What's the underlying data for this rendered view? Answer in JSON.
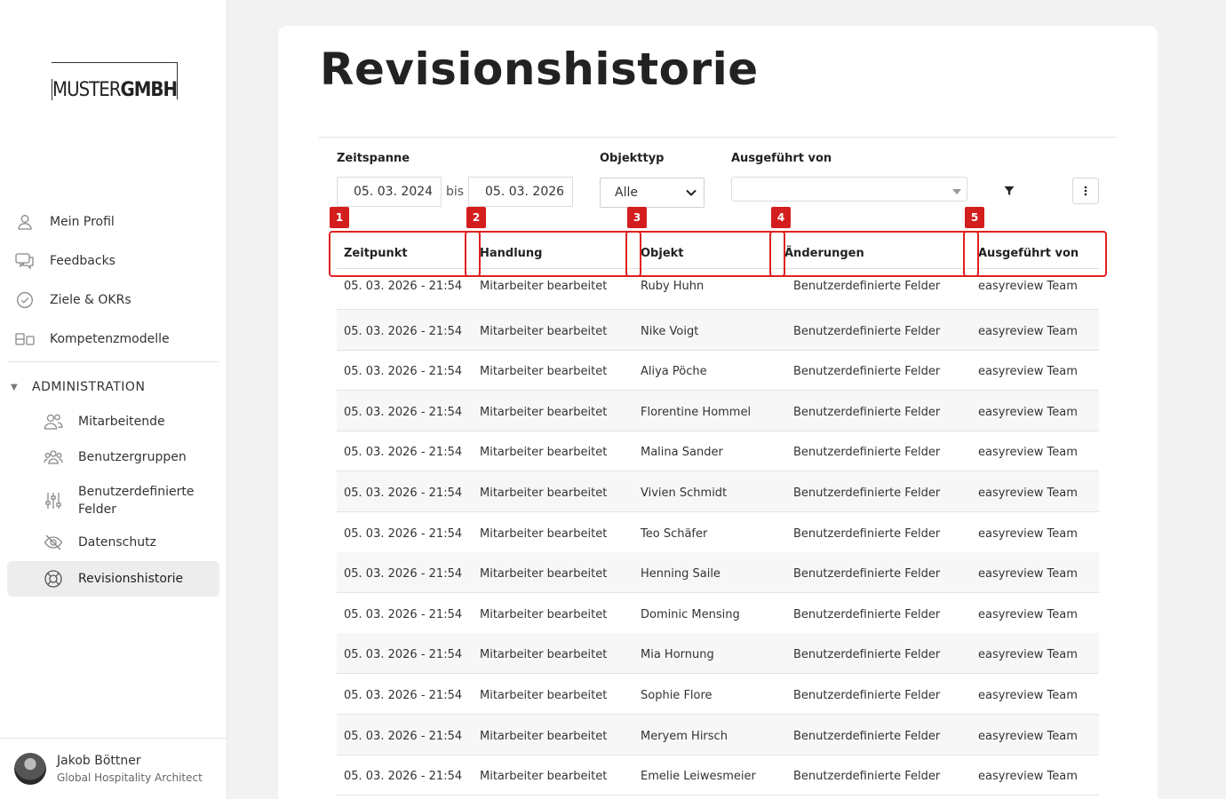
{
  "sidebar": {
    "logo": {
      "light": "MUSTER",
      "bold": "GMBH"
    },
    "items": [
      {
        "label": "Mein Profil",
        "icon": "user-icon"
      },
      {
        "label": "Feedbacks",
        "icon": "chat-icon"
      },
      {
        "label": "Ziele & OKRs",
        "icon": "check-circle-icon"
      },
      {
        "label": "Kompetenzmodelle",
        "icon": "blocks-icon"
      }
    ],
    "section": "ADMINISTRATION",
    "admin_items": [
      {
        "label": "Mitarbeitende",
        "icon": "people-icon"
      },
      {
        "label": "Benutzergruppen",
        "icon": "group-icon"
      },
      {
        "label": "Benutzerdefinierte Felder",
        "icon": "sliders-icon"
      },
      {
        "label": "Datenschutz",
        "icon": "eye-off-icon"
      },
      {
        "label": "Revisionshistorie",
        "icon": "lifebuoy-icon"
      }
    ],
    "user": {
      "name": "Jakob Böttner",
      "role": "Global Hospitality Architect"
    }
  },
  "main": {
    "title": "Revisionshistorie",
    "filters": {
      "zeitspanne_label": "Zeitspanne",
      "date_from": "05. 03. 2024",
      "bis": "bis",
      "date_to": "05. 03. 2026",
      "objekttyp_label": "Objekttyp",
      "objekttyp_value": "Alle",
      "ausgefuehrt_label": "Ausgeführt von",
      "ausgefuehrt_value": ""
    },
    "columns": [
      "Zeitpunkt",
      "Handlung",
      "Objekt",
      "Änderungen",
      "Ausgeführt von"
    ],
    "rows": [
      [
        "05. 03. 2026 - 21:54",
        "Mitarbeiter bearbeitet",
        "Ruby Huhn",
        "Benutzerdefinierte Felder",
        "easyreview Team"
      ],
      [
        "05. 03. 2026 - 21:54",
        "Mitarbeiter bearbeitet",
        "Nike Voigt",
        "Benutzerdefinierte Felder",
        "easyreview Team"
      ],
      [
        "05. 03. 2026 - 21:54",
        "Mitarbeiter bearbeitet",
        "Aliya Pöche",
        "Benutzerdefinierte Felder",
        "easyreview Team"
      ],
      [
        "05. 03. 2026 - 21:54",
        "Mitarbeiter bearbeitet",
        "Florentine Hommel",
        "Benutzerdefinierte Felder",
        "easyreview Team"
      ],
      [
        "05. 03. 2026 - 21:54",
        "Mitarbeiter bearbeitet",
        "Malina Sander",
        "Benutzerdefinierte Felder",
        "easyreview Team"
      ],
      [
        "05. 03. 2026 - 21:54",
        "Mitarbeiter bearbeitet",
        "Vivien Schmidt",
        "Benutzerdefinierte Felder",
        "easyreview Team"
      ],
      [
        "05. 03. 2026 - 21:54",
        "Mitarbeiter bearbeitet",
        "Teo Schäfer",
        "Benutzerdefinierte Felder",
        "easyreview Team"
      ],
      [
        "05. 03. 2026 - 21:54",
        "Mitarbeiter bearbeitet",
        "Henning Saile",
        "Benutzerdefinierte Felder",
        "easyreview Team"
      ],
      [
        "05. 03. 2026 - 21:54",
        "Mitarbeiter bearbeitet",
        "Dominic Mensing",
        "Benutzerdefinierte Felder",
        "easyreview Team"
      ],
      [
        "05. 03. 2026 - 21:54",
        "Mitarbeiter bearbeitet",
        "Mia Hornung",
        "Benutzerdefinierte Felder",
        "easyreview Team"
      ],
      [
        "05. 03. 2026 - 21:54",
        "Mitarbeiter bearbeitet",
        "Sophie Flore",
        "Benutzerdefinierte Felder",
        "easyreview Team"
      ],
      [
        "05. 03. 2026 - 21:54",
        "Mitarbeiter bearbeitet",
        "Meryem Hirsch",
        "Benutzerdefinierte Felder",
        "easyreview Team"
      ],
      [
        "05. 03. 2026 - 21:54",
        "Mitarbeiter bearbeitet",
        "Emelie Leiwesmeier",
        "Benutzerdefinierte Felder",
        "easyreview Team"
      ]
    ]
  },
  "annotations": [
    "1",
    "2",
    "3",
    "4",
    "5"
  ],
  "colors": {
    "annotation": "#d41e1e",
    "active_bg": "#ededed"
  }
}
